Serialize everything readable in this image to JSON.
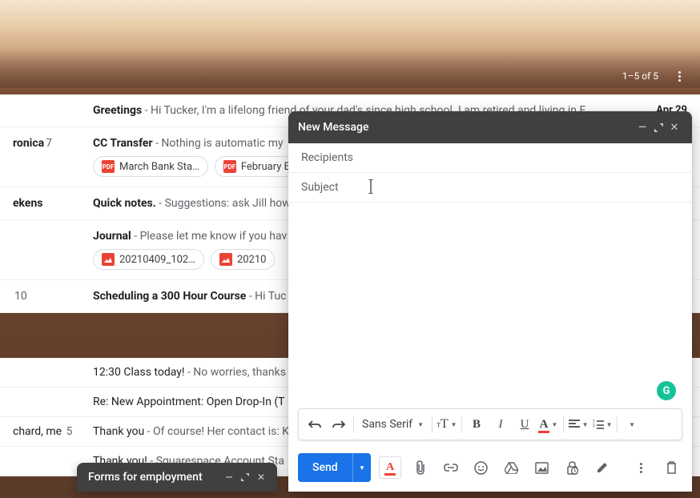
{
  "header": {
    "pagination": "1–5 of 5"
  },
  "mail": [
    {
      "sender": "",
      "subject": "Greetings",
      "preview": " - Hi Tucker, I'm a lifelong friend of your dad's since high school. I am retired and living in F…",
      "date": "Apr 29",
      "unread": true,
      "chips": []
    },
    {
      "sender": "ronica",
      "count": "7",
      "subject": "CC Transfer",
      "preview": " - Nothing is automatic my",
      "date": "",
      "unread": true,
      "chips": [
        {
          "type": "pdf",
          "label": "March Bank Sta…"
        },
        {
          "type": "pdf",
          "label": "February Bank"
        }
      ]
    },
    {
      "sender": "ekens",
      "subject": "Quick notes.",
      "preview": " - Suggestions: ask Jill how",
      "date": "",
      "unread": true
    },
    {
      "sender": "",
      "subject": "Journal",
      "preview": " - Please let me know if you hav",
      "date": "",
      "unread": true,
      "chips": [
        {
          "type": "img",
          "label": "20210409_102…"
        },
        {
          "type": "img",
          "label": "20210"
        }
      ]
    },
    {
      "sender": "",
      "count": "10",
      "subject": "Scheduling a 300 Hour Course",
      "preview": " - Hi Tuc",
      "date": "",
      "unread": true
    }
  ],
  "mail2": [
    {
      "sender": "",
      "subject": "12:30 Class today!",
      "preview": " - No worries, thanks",
      "unread": false
    },
    {
      "sender": "",
      "subject": "Re: New Appointment: Open Drop-In (T",
      "preview": "",
      "unread": false
    },
    {
      "sender": "chard, me",
      "count": "5",
      "subject": "Thank you",
      "preview": " - Of course! Her contact is: K",
      "unread": false
    },
    {
      "sender": "",
      "subject": "Thank you!",
      "preview": " - Squarespace Account Sta",
      "unread": false
    }
  ],
  "compose": {
    "title": "New Message",
    "recipients_placeholder": "Recipients",
    "subject_placeholder": "Subject",
    "font_family": "Sans Serif",
    "send_label": "Send"
  },
  "mini_compose": {
    "title": "Forms for employment"
  },
  "icons": {
    "bold": "B",
    "italic": "I",
    "triangle": "▼",
    "textA": "A",
    "dot": "●"
  }
}
